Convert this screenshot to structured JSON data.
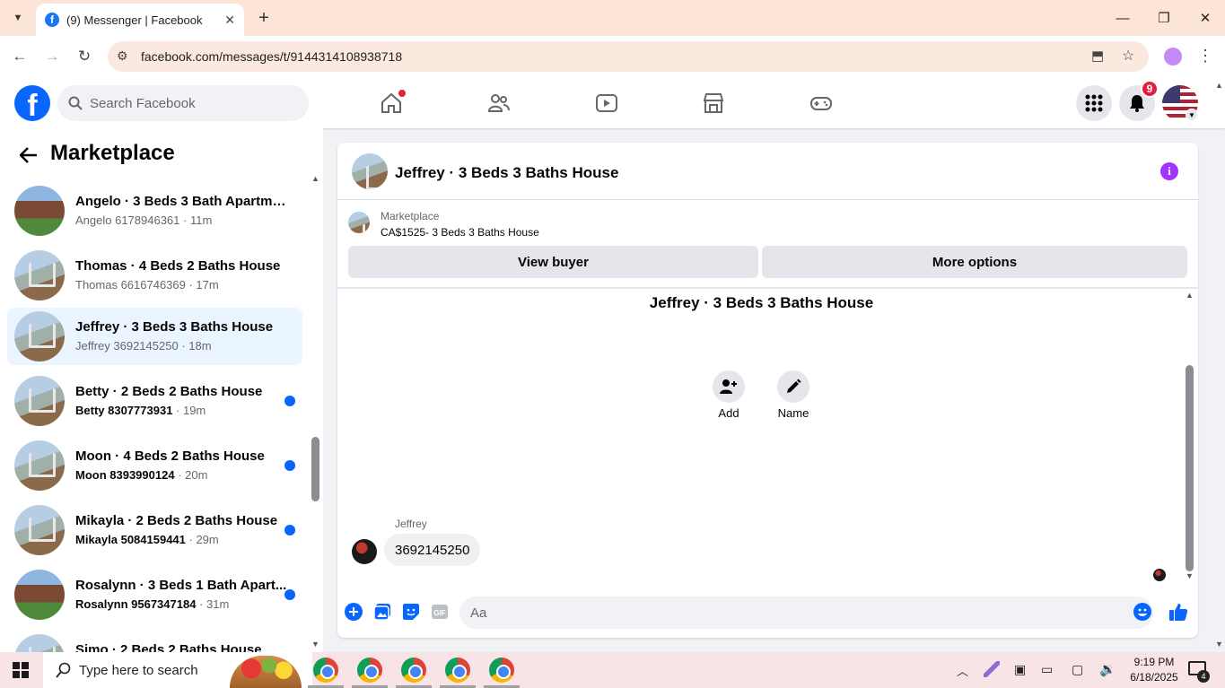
{
  "browser": {
    "tab_title": "(9) Messenger | Facebook",
    "url": "facebook.com/messages/t/9144314108938718"
  },
  "header": {
    "search_placeholder": "Search Facebook",
    "notification_count": "9"
  },
  "sidebar": {
    "title": "Marketplace",
    "conversations": [
      {
        "name": "Angelo · 3 Beds 3 Bath Apartme...",
        "sub": "Angelo 6178946361",
        "time": " · 11m",
        "unread": false,
        "thumb": "apt"
      },
      {
        "name": "Thomas · 4 Beds 2 Baths House",
        "sub": "Thomas 6616746369",
        "time": " · 17m",
        "unread": false,
        "thumb": "house"
      },
      {
        "name": "Jeffrey · 3 Beds 3 Baths House",
        "sub": "Jeffrey 3692145250",
        "time": " · 18m",
        "unread": false,
        "thumb": "house",
        "selected": true
      },
      {
        "name": "Betty · 2 Beds 2 Baths House",
        "sub": "Betty 8307773931",
        "time": " · 19m",
        "unread": true,
        "thumb": "house"
      },
      {
        "name": "Moon · 4 Beds 2 Baths House",
        "sub": "Moon 8393990124",
        "time": " · 20m",
        "unread": true,
        "thumb": "house"
      },
      {
        "name": "Mikayla · 2 Beds 2 Baths House",
        "sub": "Mikayla 5084159441",
        "time": " · 29m",
        "unread": true,
        "thumb": "house"
      },
      {
        "name": "Rosalynn · 3 Beds 1 Bath Apart...",
        "sub": "Rosalynn 9567347184",
        "time": " · 31m",
        "unread": true,
        "thumb": "apt"
      },
      {
        "name": "Simo · 2 Beds 2 Baths House",
        "sub": "",
        "time": "",
        "unread": false,
        "thumb": "house"
      }
    ]
  },
  "chat": {
    "title": "Jeffrey · 3 Beds 3 Baths House",
    "marketplace_label": "Marketplace",
    "listing": "CA$1525- 3 Beds 3 Baths House",
    "view_buyer": "View buyer",
    "more_options": "More options",
    "conversation_title": "Jeffrey · 3 Beds 3 Baths House",
    "add_label": "Add",
    "name_label": "Name",
    "sender": "Jeffrey",
    "message": "3692145250",
    "input_placeholder": "Aa"
  },
  "taskbar": {
    "search_placeholder": "Type here to search",
    "time": "9:19 PM",
    "date": "6/18/2025",
    "notification_count": "4"
  },
  "colors": {
    "accent": "#0866ff",
    "info": "#a033ff",
    "badge": "#e41e3f"
  }
}
